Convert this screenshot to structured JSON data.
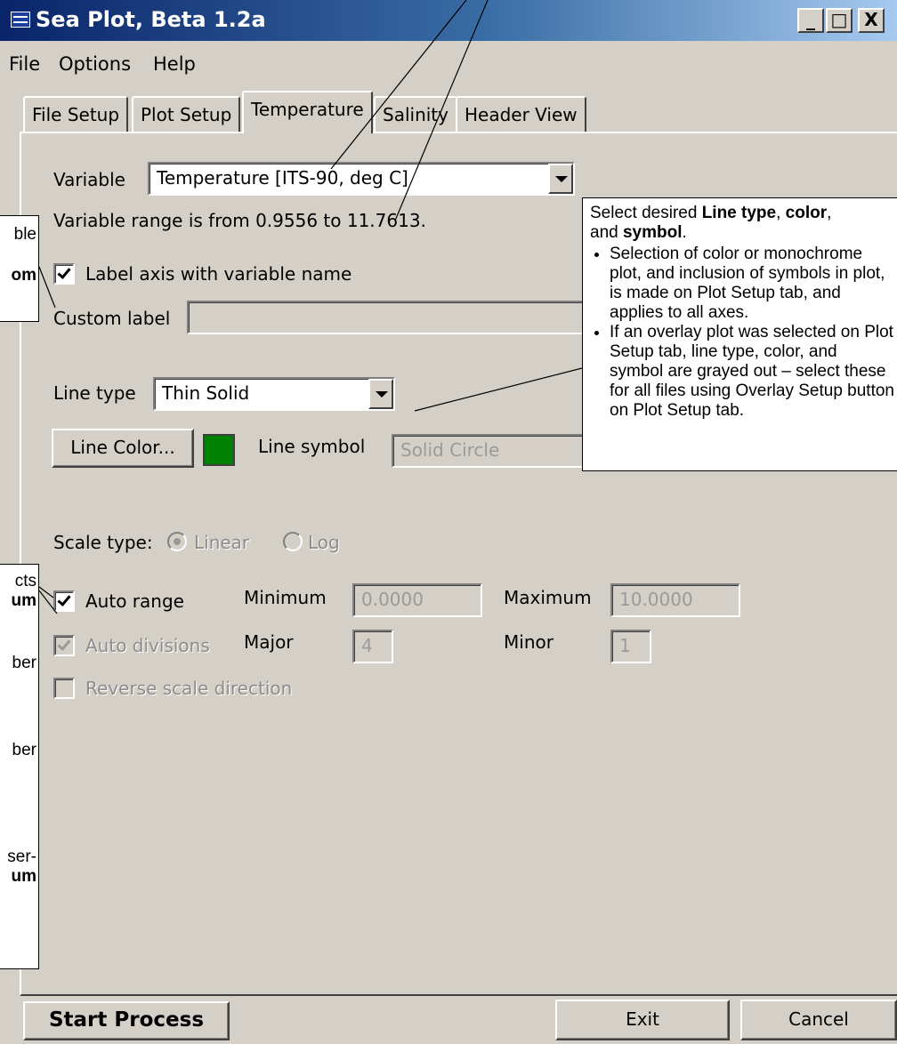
{
  "window": {
    "title": "Sea Plot, Beta 1.2a",
    "controls": {
      "minimize": "_",
      "maximize": "□",
      "close": "X"
    }
  },
  "menu": [
    "File",
    "Options",
    "Help"
  ],
  "tabs": [
    {
      "label": "File Setup",
      "active": false
    },
    {
      "label": "Plot Setup",
      "active": false
    },
    {
      "label": "Temperature",
      "active": true
    },
    {
      "label": "Salinity",
      "active": false
    },
    {
      "label": "Header View",
      "active": false
    }
  ],
  "panel": {
    "variable_label": "Variable",
    "variable_value": "Temperature [ITS-90, deg C]",
    "range_text": "Variable range is from 0.9556 to 11.7613.",
    "label_axis": {
      "label": "Label axis with variable name",
      "checked": true
    },
    "custom_label": {
      "label": "Custom label",
      "value": ""
    },
    "line_type": {
      "label": "Line type",
      "value": "Thin Solid"
    },
    "line_color_button": "Line Color...",
    "line_color_swatch": "#008000",
    "line_symbol": {
      "label": "Line symbol",
      "value": "Solid Circle"
    },
    "scale_type": {
      "label": "Scale type:",
      "options": [
        {
          "label": "Linear",
          "selected": true
        },
        {
          "label": "Log",
          "selected": false
        }
      ]
    },
    "auto_range": {
      "label": "Auto range",
      "checked": true
    },
    "minimum": {
      "label": "Minimum",
      "value": "0.0000"
    },
    "maximum": {
      "label": "Maximum",
      "value": "10.0000"
    },
    "auto_divisions": {
      "label": "Auto divisions",
      "checked": true
    },
    "major": {
      "label": "Major",
      "value": "4"
    },
    "minor": {
      "label": "Minor",
      "value": "1"
    },
    "reverse_scale": {
      "label": "Reverse scale direction",
      "checked": false
    }
  },
  "footer": {
    "start_process": "Start Process",
    "exit": "Exit",
    "cancel": "Cancel"
  },
  "callouts": {
    "line": {
      "intro_1": "Select desired ",
      "intro_b1": "Line type",
      "intro_2": ", ",
      "intro_b2": "color",
      "intro_3": ",",
      "intro_4": "and ",
      "intro_b3": "symbol",
      "intro_5": ".",
      "bullets": [
        "Selection of color or monochrome plot, and inclusion of symbols in plot, is made on Plot Setup tab, and applies to all axes.",
        "If an overlay plot was selected on Plot Setup tab, line type, color, and symbol are grayed out – select these for all files using Overlay Setup button on Plot Setup tab."
      ]
    },
    "left_top": {
      "line1": "ble",
      "line2": "om"
    },
    "left_bottom": {
      "f1": "cts",
      "f2": "um",
      "f3": "ber",
      "f4": "ber",
      "f5": "ser-",
      "f6": "um"
    }
  },
  "colors": {
    "window_bg": "#d4d0c8",
    "title_start": "#0a246a",
    "title_end": "#a6caf0",
    "swatch_green": "#008000"
  }
}
